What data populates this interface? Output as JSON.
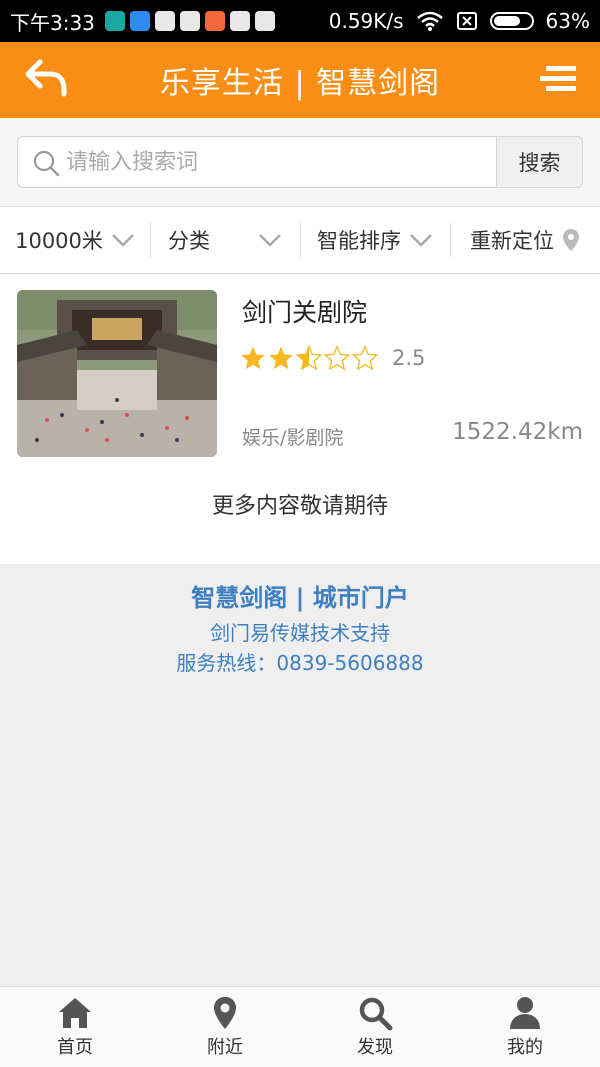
{
  "status_bar": {
    "time": "下午3:33",
    "network_speed": "0.59K/s",
    "battery": "63%",
    "app_icons": [
      {
        "name": "app-icon",
        "color": "#1aa8a0"
      },
      {
        "name": "app-icon",
        "color": "#2d8cf0"
      },
      {
        "name": "video-app-icon",
        "color": "#e8e8e8"
      },
      {
        "name": "video-app-icon",
        "color": "#e8e8e8"
      },
      {
        "name": "mi-app-icon",
        "color": "#f5683d"
      },
      {
        "name": "video-app-icon",
        "color": "#e8e8e8"
      },
      {
        "name": "video-app-icon",
        "color": "#e8e8e8"
      }
    ]
  },
  "header": {
    "title": "乐享生活 | 智慧剑阁",
    "back_icon": "back-arrow-icon",
    "menu_icon": "menu-icon",
    "bg_color": "#f98e16"
  },
  "search": {
    "placeholder": "请输入搜索词",
    "value": "",
    "button_label": "搜索"
  },
  "filters": [
    {
      "label": "10000米",
      "icon": "chevron-down-icon"
    },
    {
      "label": "分类",
      "icon": "chevron-down-icon"
    },
    {
      "label": "智能排序",
      "icon": "chevron-down-icon"
    },
    {
      "label": "重新定位",
      "icon": "location-pin-icon"
    }
  ],
  "listings": [
    {
      "name": "剑门关剧院",
      "rating": 2.5,
      "rating_text": "2.5",
      "max_stars": 5,
      "category": "娱乐/影剧院",
      "distance": "1522.42km"
    }
  ],
  "more_text": "更多内容敬请期待",
  "footer": {
    "brand": "智慧剑阁 | 城市门户",
    "support": "剑门易传媒技术支持",
    "hotline": "服务热线：0839-5606888",
    "color": "#3d7fc1"
  },
  "bottom_nav": [
    {
      "label": "首页",
      "icon": "home-icon"
    },
    {
      "label": "附近",
      "icon": "location-pin-icon"
    },
    {
      "label": "发现",
      "icon": "search-icon"
    },
    {
      "label": "我的",
      "icon": "user-icon"
    }
  ]
}
